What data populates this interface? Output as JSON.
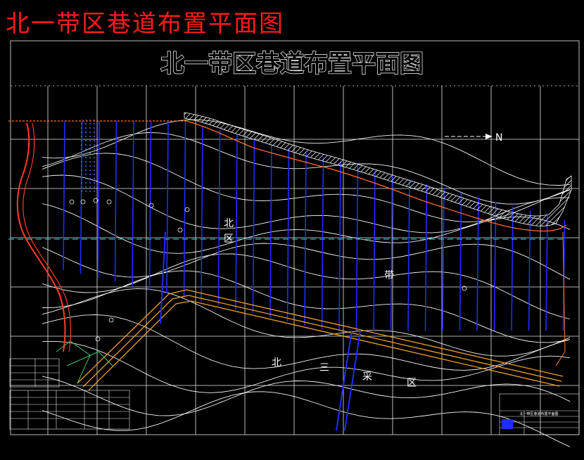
{
  "header": {
    "red_title": "北一带区巷道布置平面图",
    "main_title": "北一带区巷道布置平面图"
  },
  "labels": {
    "north": "N",
    "zone_bei": "北",
    "zone_qu": "区",
    "zone_dai": "带",
    "bottom_bei": "北",
    "bottom_san": "三",
    "bottom_cai": "采",
    "bottom_qu": "区"
  },
  "title_block": {
    "name": "北一带区巷道布置平面图"
  },
  "colors": {
    "background": "#000000",
    "grid": "#ffffff",
    "contour": "#ffffff",
    "roadway": "#1f2cff",
    "tunnel": "#f0a020",
    "red_boundary": "#ff2a2a",
    "cyan": "#00e5ff",
    "hatch": "#ffffff"
  }
}
